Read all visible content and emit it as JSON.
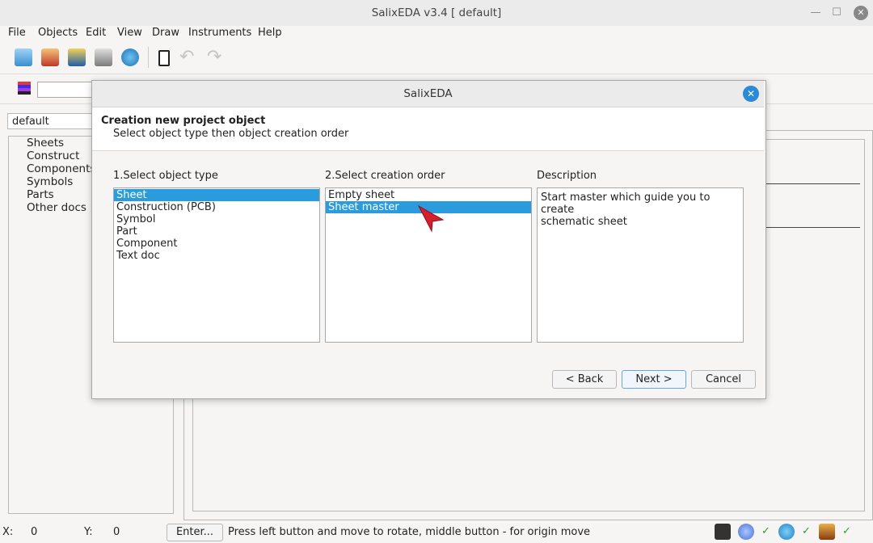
{
  "window": {
    "title": "SalixEDA v3.4 [ default]"
  },
  "menubar": {
    "items": [
      "File",
      "Objects",
      "Edit",
      "View",
      "Draw",
      "Instruments",
      "Help"
    ]
  },
  "toolbar": {
    "icons": [
      "new-file-icon",
      "open-project-icon",
      "save-icon",
      "print-icon",
      "cloud-sync-icon",
      "page-icon",
      "undo-icon",
      "redo-icon"
    ]
  },
  "left_panel": {
    "project_combo": "default",
    "tree_items": [
      "Sheets",
      "Construct",
      "Components",
      "Symbols",
      "Parts",
      "Other docs"
    ]
  },
  "dialog": {
    "title": "SalixEDA",
    "header_title": "Creation new project object",
    "header_subtitle": "Select object type then object creation order",
    "col1_label": "1.Select object type",
    "col2_label": "2.Select creation order",
    "col3_label": "Description",
    "object_types": [
      "Sheet",
      "Construction (PCB)",
      "Symbol",
      "Part",
      "Component",
      "Text doc"
    ],
    "selected_object_type": "Sheet",
    "creation_orders": [
      "Empty sheet",
      "Sheet master"
    ],
    "selected_creation_order": "Sheet master",
    "description_lines": [
      "Start master which guide you to create",
      "schematic sheet"
    ],
    "buttons": {
      "back": "< Back",
      "next": "Next >",
      "cancel": "Cancel"
    },
    "accent_color": "#2a9bdc"
  },
  "statusbar": {
    "x_label": "X:",
    "x_value": "0",
    "y_label": "Y:",
    "y_value": "0",
    "enter_button": "Enter...",
    "message": "Press left button and move to rotate, middle button - for origin move",
    "check_mark": "✓"
  }
}
